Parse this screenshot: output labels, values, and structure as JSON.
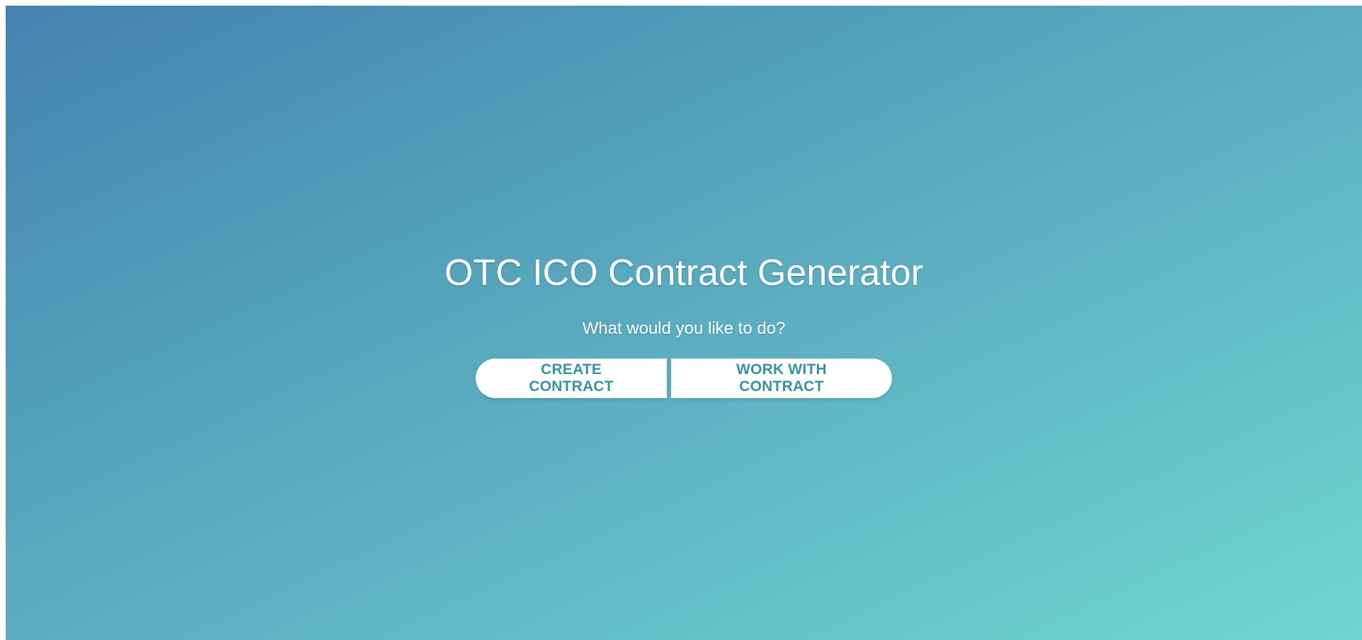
{
  "hero": {
    "title": "OTC ICO Contract Generator",
    "subtitle": "What would you like to do?"
  },
  "actions": {
    "create_label": "CREATE CONTRACT",
    "work_label": "WORK WITH CONTRACT"
  },
  "colors": {
    "gradient_start": "#4682b1",
    "gradient_end": "#6fd6d1",
    "button_text": "#35949f",
    "button_bg": "#ffffff"
  }
}
